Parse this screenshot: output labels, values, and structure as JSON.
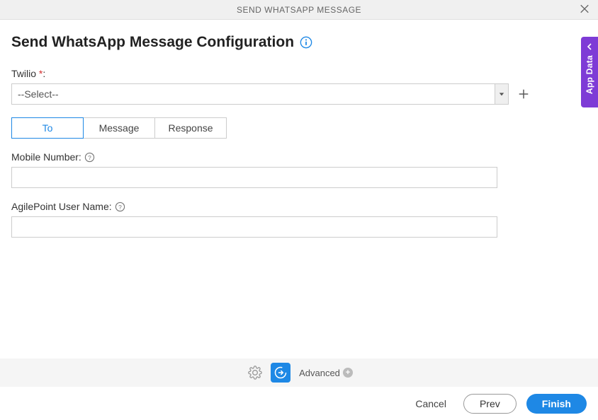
{
  "header": {
    "title": "SEND WHATSAPP MESSAGE"
  },
  "page": {
    "title": "Send WhatsApp Message Configuration"
  },
  "twilio": {
    "label": "Twilio",
    "required_mark": "*",
    "colon": ":",
    "select_value": "--Select--"
  },
  "tabs": {
    "to": "To",
    "message": "Message",
    "response": "Response"
  },
  "form": {
    "mobile": {
      "label": "Mobile Number:",
      "value": ""
    },
    "user": {
      "label": "AgilePoint User Name:",
      "value": ""
    }
  },
  "side_panel": {
    "label": "App Data"
  },
  "toolbar": {
    "advanced_label": "Advanced"
  },
  "footer": {
    "cancel": "Cancel",
    "prev": "Prev",
    "finish": "Finish"
  }
}
